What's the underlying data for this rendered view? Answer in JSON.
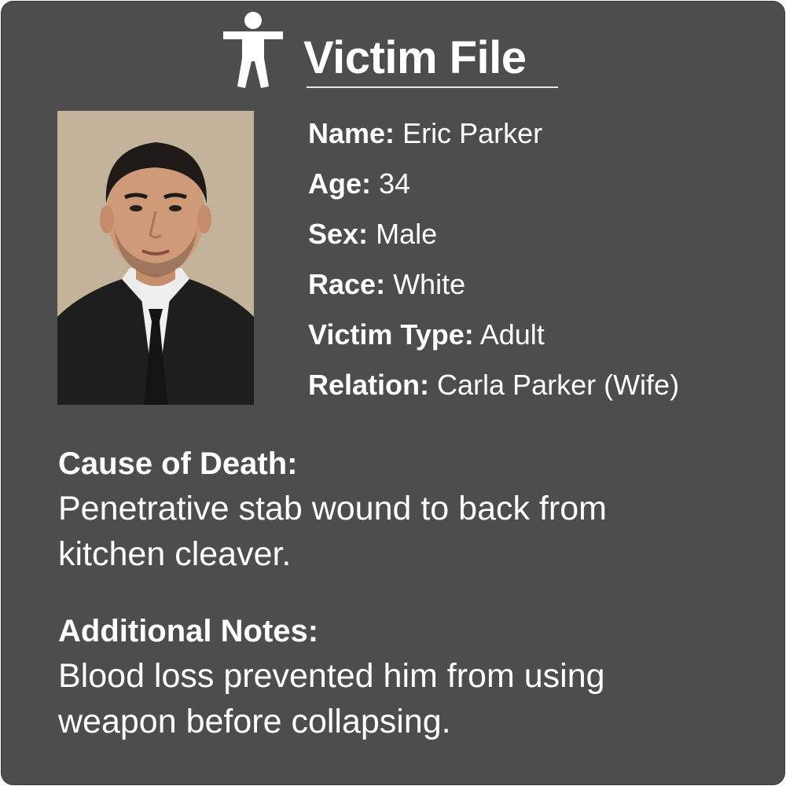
{
  "header": {
    "title": "Victim File",
    "icon": "person-icon"
  },
  "photo": {
    "alt": "Portrait of Eric Parker"
  },
  "facts": [
    {
      "label": "Name:",
      "value": "Eric Parker"
    },
    {
      "label": "Age:",
      "value": "34"
    },
    {
      "label": "Sex:",
      "value": "Male"
    },
    {
      "label": "Race:",
      "value": "White"
    },
    {
      "label": "Victim Type:",
      "value": "Adult"
    },
    {
      "label": "Relation:",
      "value": "Carla Parker (Wife)"
    }
  ],
  "cause_of_death": {
    "heading": "Cause of Death:",
    "line1": "Penetrative stab wound to back from",
    "line2": "kitchen cleaver."
  },
  "additional_notes": {
    "heading": "Additional Notes:",
    "line1": "Blood loss prevented him from using",
    "line2": "weapon before collapsing."
  },
  "colors": {
    "background": "#4d4d4d",
    "text": "#ffffff"
  }
}
